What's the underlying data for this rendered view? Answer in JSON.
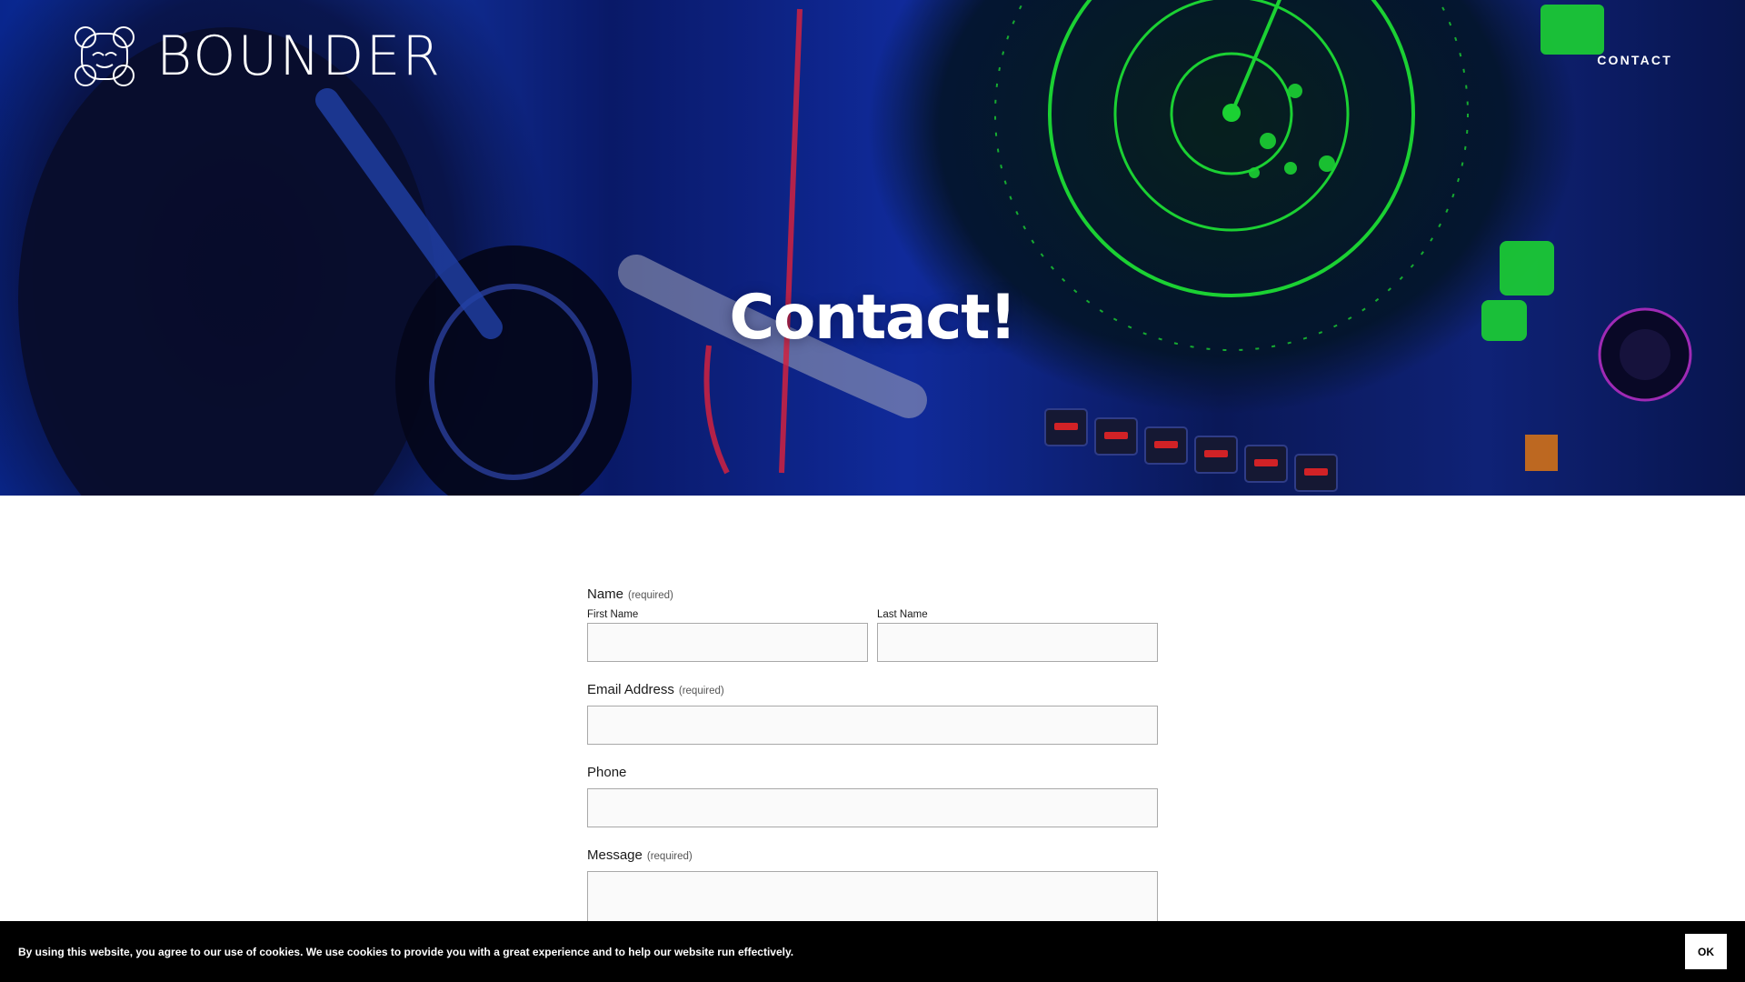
{
  "brand": {
    "name": "BOUNDER",
    "logo_icon": "bear-face-icon"
  },
  "nav": {
    "contact_label": "CONTACT"
  },
  "hero": {
    "title": "Contact!",
    "background": "radar-console-photo"
  },
  "form": {
    "name": {
      "label": "Name",
      "required": "(required)",
      "first_label": "First Name",
      "last_label": "Last Name",
      "first_value": "",
      "last_value": ""
    },
    "email": {
      "label": "Email Address",
      "required": "(required)",
      "value": ""
    },
    "phone": {
      "label": "Phone",
      "value": ""
    },
    "message": {
      "label": "Message",
      "required": "(required)",
      "value": ""
    }
  },
  "cookie": {
    "text": "By using this website, you agree to our use of cookies. We use cookies to provide you with a great experience and to help our website run effectively.",
    "ok_label": "OK"
  },
  "colors": {
    "hero_blue": "#1434b8",
    "radar_green": "#22ff3a",
    "panel_red": "#ff2040",
    "cookie_bg": "#000000"
  }
}
